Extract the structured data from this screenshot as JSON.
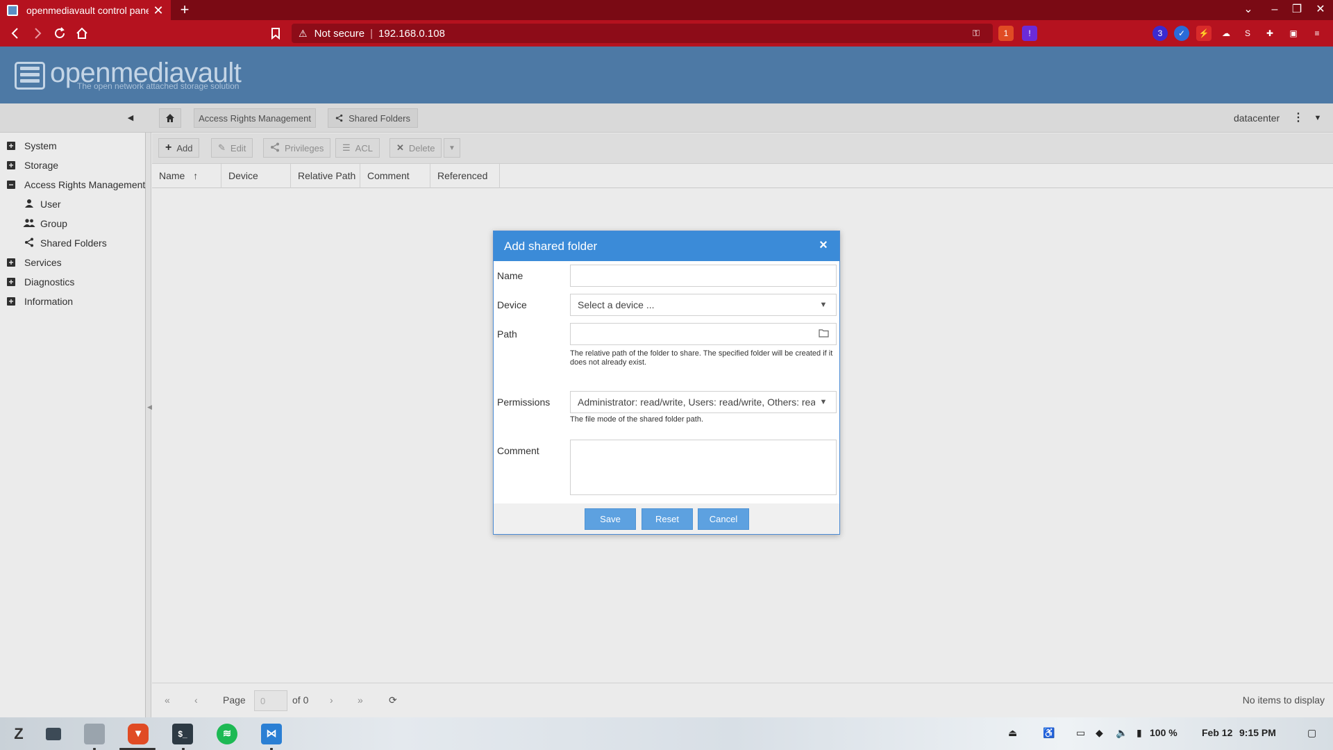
{
  "browser": {
    "tab_title": "openmediavault control panel",
    "tab_close": "✕",
    "new_tab": "+",
    "security_label": "Not secure",
    "url": "192.168.0.108",
    "brave_badge": "1",
    "rewards_badge": "!",
    "ext_badge": "3"
  },
  "app": {
    "logo_text": "openmediavault",
    "logo_subtitle": "The open network attached storage solution"
  },
  "breadcrumb": {
    "section": "Access Rights Management",
    "page": "Shared Folders",
    "user": "datacenter"
  },
  "sidebar": {
    "items": [
      {
        "label": "System",
        "expander": "+"
      },
      {
        "label": "Storage",
        "expander": "+"
      },
      {
        "label": "Access Rights Management",
        "expander": "−"
      },
      {
        "label": "User"
      },
      {
        "label": "Group"
      },
      {
        "label": "Shared Folders"
      },
      {
        "label": "Services",
        "expander": "+"
      },
      {
        "label": "Diagnostics",
        "expander": "+"
      },
      {
        "label": "Information",
        "expander": "+"
      }
    ]
  },
  "grid": {
    "toolbar": {
      "add": "Add",
      "edit": "Edit",
      "privileges": "Privileges",
      "acl": "ACL",
      "delete": "Delete"
    },
    "columns": [
      "Name",
      "Device",
      "Relative Path",
      "Comment",
      "Referenced"
    ],
    "sort_indicator": "↑",
    "pager": {
      "page_label": "Page",
      "page_value": "0",
      "of_label": "of 0",
      "empty_text": "No items to display"
    }
  },
  "dialog": {
    "title": "Add shared folder",
    "fields": {
      "name_label": "Name",
      "name_value": "",
      "device_label": "Device",
      "device_placeholder": "Select a device ...",
      "path_label": "Path",
      "path_value": "",
      "path_help": "The relative path of the folder to share. The specified folder will be created if it does not already exist.",
      "permissions_label": "Permissions",
      "permissions_value": "Administrator: read/write, Users: read/write, Others: read-only",
      "permissions_help": "The file mode of the shared folder path.",
      "comment_label": "Comment",
      "comment_value": ""
    },
    "buttons": {
      "save": "Save",
      "reset": "Reset",
      "cancel": "Cancel"
    }
  },
  "taskbar": {
    "battery": "100 %",
    "date": "Feb 12",
    "time": "9:15 PM"
  },
  "colors": {
    "browser_red": "#b5121f",
    "header_blue": "#4d79a5",
    "dialog_header": "#3b8bd8",
    "dialog_button": "#5da1e0"
  }
}
